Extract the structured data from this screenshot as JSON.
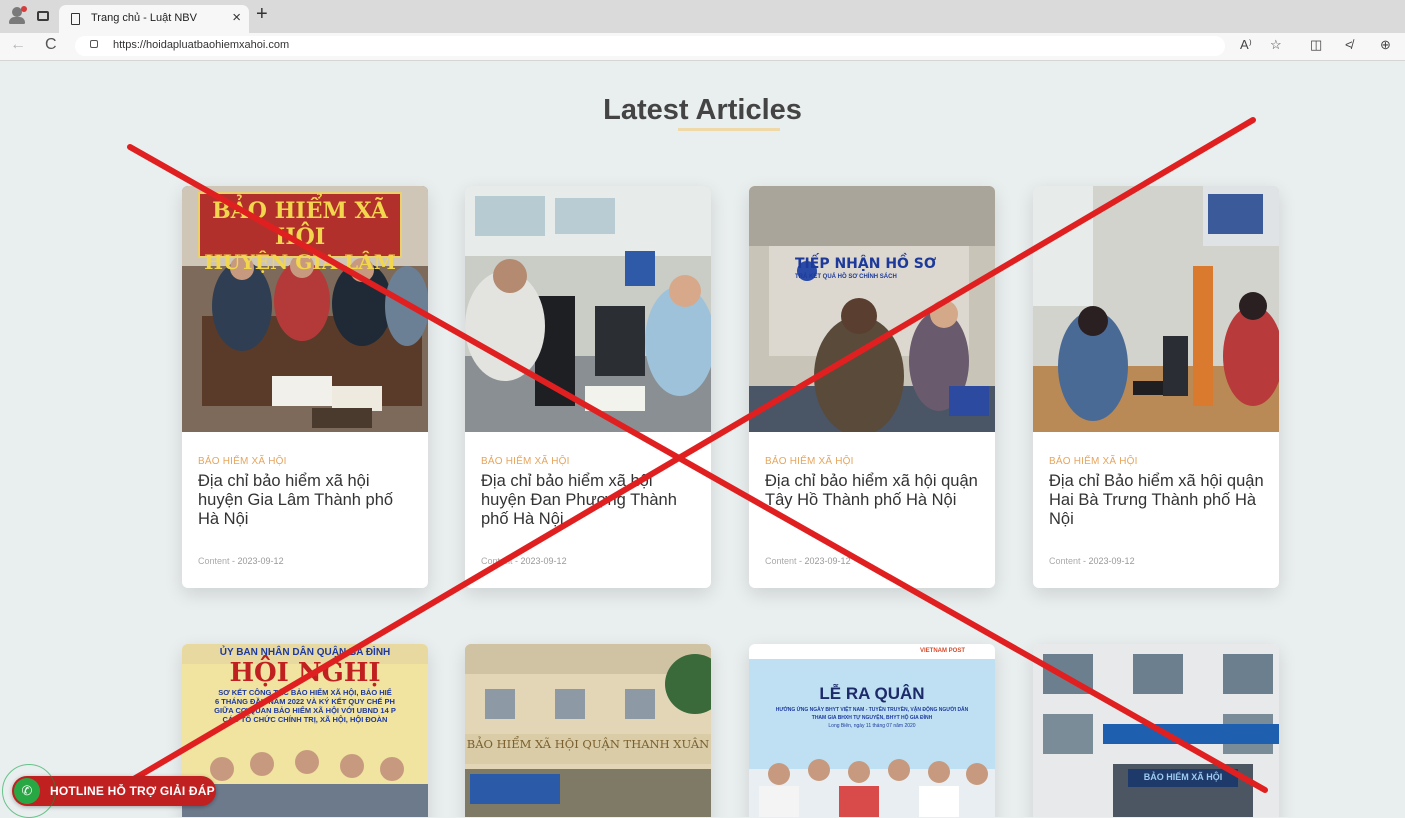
{
  "browser": {
    "tab_title": "Trang chủ - Luật NBV",
    "tab_close": "×",
    "new_tab": "+",
    "url": "https://hoidapluatbaohiemxahoi.com",
    "icons": [
      "profile-icon",
      "tabs-icon",
      "page-icon",
      "back-icon",
      "reload-icon",
      "lock-icon",
      "read-aloud-icon",
      "favorite-icon",
      "split-screen-icon",
      "favorites-list-icon",
      "extensions-icon"
    ],
    "nav": {
      "back": "←",
      "reload": "C"
    },
    "right_icons": {
      "read": "A⁾",
      "star": "☆",
      "split": "◫",
      "favs": "≮",
      "ext": "⊕"
    }
  },
  "page": {
    "heading": "Latest Articles",
    "accent_color": "#e6a55c",
    "overlay_color": "#e02020",
    "articles": [
      {
        "category": "BẢO HIỂM XÃ HỘI",
        "title": "Địa chỉ bảo hiểm xã hội huyện Gia Lâm Thành phố Hà Nội",
        "author": "Content",
        "date": "2023-09-12"
      },
      {
        "category": "BẢO HIỂM XÃ HỘI",
        "title": "Địa chỉ bảo hiểm xã hội huyện Đan Phượng Thành phố Hà Nội",
        "author": "Content",
        "date": "2023-09-12"
      },
      {
        "category": "BẢO HIỂM XÃ HỘI",
        "title": "Địa chỉ bảo hiểm xã hội quận Tây Hồ Thành phố Hà Nội",
        "author": "Content",
        "date": "2023-09-12"
      },
      {
        "category": "BẢO HIỂM XÃ HỘI",
        "title": "Địa chỉ Bảo hiểm xã hội quận Hai Bà Trưng Thành phố Hà Nội",
        "author": "Content",
        "date": "2023-09-12"
      }
    ],
    "image_texts": {
      "sign1_line1": "BẢO HIỂM XÃ HỘI",
      "sign1_line2": "HUYỆN GIA LÂM",
      "sign3": "TIẾP NHẬN HỒ SƠ",
      "sign3_sub": "TRẢ KẾT QUẢ HỒ SƠ CHÍNH SÁCH",
      "sign5_top": "ỦY BAN NHÂN DÂN QUẬN BA ĐÌNH",
      "sign5_main": "HỘI NGHỊ",
      "sign5_sub1": "SƠ KẾT CÔNG TÁC BẢO HIỂM XÃ HỘI, BẢO HIỂ",
      "sign5_sub2": "6 THÁNG ĐẦU NĂM 2022 VÀ KÝ KẾT QUY CHẾ PH",
      "sign5_sub3": "GIỮA CƠ QUAN BẢO HIỂM XÃ HỘI VỚI UBND 14 P",
      "sign5_sub4": "CÁC TỔ CHỨC CHÍNH TRỊ, XÃ HỘI, HỘI ĐOÀN",
      "sign6": "BẢO HIỂM XÃ HỘI QUẬN THANH XUÂN",
      "sign7_main": "LỄ RA QUÂN",
      "sign7_sub1": "HƯỞNG ỨNG NGÀY BHYT VIỆT NAM - TUYÊN TRUYỀN, VẬN ĐỘNG NGƯỜI DÂN",
      "sign7_sub2": "THAM GIA BHXH TỰ NGUYỆN, BHYT HỘ GIA ĐÌNH",
      "sign7_sub3": "Long Biên, ngày 11 tháng 07 năm 2020",
      "sign7_logo": "VIETNAM POST",
      "sign8": "BẢO HIỂM XÃ HỘI"
    }
  },
  "hotline": {
    "label": "HOTLINE HỖ TRỢ GIẢI ĐÁP",
    "icon": "phone-icon"
  }
}
